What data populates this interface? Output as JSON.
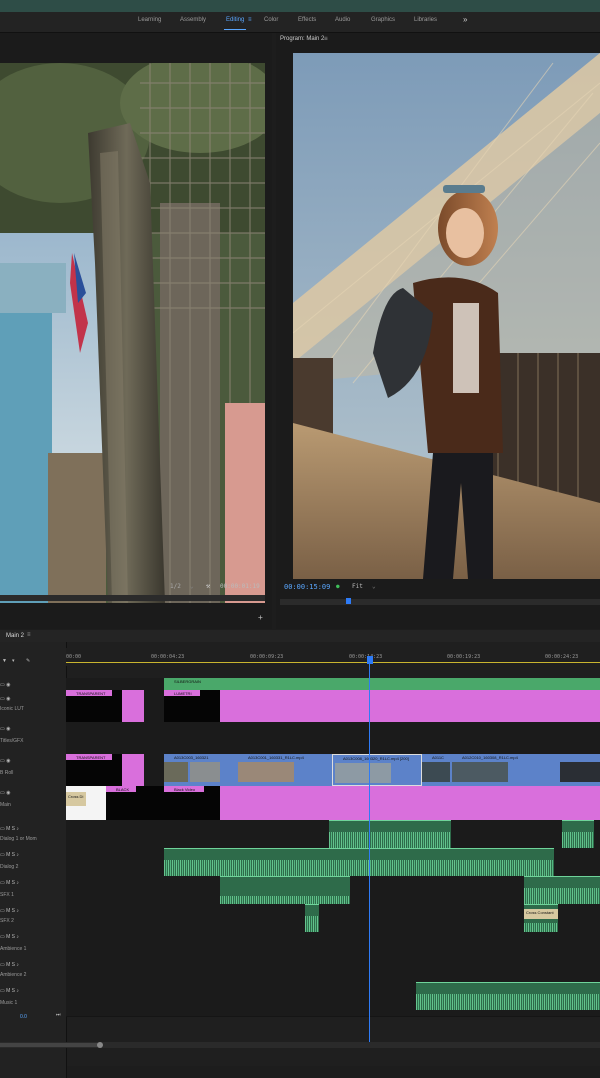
{
  "workspaces": [
    "Learning",
    "Assembly",
    "Editing",
    "Color",
    "Effects",
    "Audio",
    "Graphics",
    "Libraries"
  ],
  "active_workspace": "Editing",
  "more_workspaces_icon": "double-chevron-right-icon",
  "program": {
    "title": "Program: Main 2",
    "timecode": "00:00:15:09",
    "fit": "Fit"
  },
  "source": {
    "zoom": "1/2",
    "timecode": "00:00:01:19"
  },
  "timeline": {
    "tab": "Main 2",
    "ruler": [
      "00:00",
      "00:00:04:23",
      "00:00:09:23",
      "00:00:14:23",
      "00:00:19:23",
      "00:00:24:23"
    ],
    "tracks": [
      {
        "label": "Iconic LUT"
      },
      {
        "label": "Titles/GFX"
      },
      {
        "label": "B Roll"
      },
      {
        "label": "Main"
      },
      {
        "label": "Dialog 1 or Mom"
      },
      {
        "label": "Dialog 2"
      },
      {
        "label": "SFX 1"
      },
      {
        "label": "SFX 2"
      },
      {
        "label": "Ambience 1"
      },
      {
        "label": "Ambience 2"
      },
      {
        "label": "Music 1"
      }
    ],
    "clips": {
      "silbergrain": "SILBERGRAIN",
      "transparent1": "TRANSPARENT",
      "lumetri": "LUMETRI",
      "transparent2": "TRANSPARENT",
      "cross1": "Cross Di",
      "broll1": "A013C003_160321",
      "broll2": "A013C001_160331_R1LC.mp4",
      "broll3": "A013C008_160320_R1LC.mp4 [200]",
      "broll4": "A011C",
      "broll5": "A012C010_160308_R1LC.mp4",
      "cross2": "Cross Di",
      "black1": "BLACK",
      "black2": "Black Video",
      "sfx_cross": "Cross Constant"
    },
    "master_value": "0.0"
  }
}
